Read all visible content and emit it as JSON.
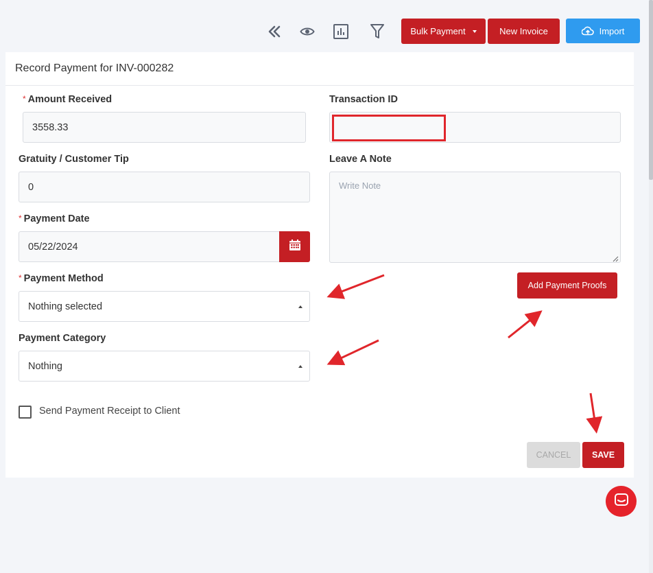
{
  "toolbar": {
    "icons": [
      "double-chevron-left-icon",
      "eye-icon",
      "bar-chart-icon",
      "filter-icon"
    ],
    "bulk_payment_label": "Bulk Payment",
    "new_invoice_label": "New Invoice",
    "import_label": "Import"
  },
  "form": {
    "title": "Record Payment for INV-000282",
    "amount_received": {
      "label": "Amount Received",
      "value": "3558.33",
      "required": true
    },
    "transaction_id": {
      "label": "Transaction ID",
      "value": ""
    },
    "gratuity": {
      "label": "Gratuity / Customer Tip",
      "value": "0"
    },
    "note": {
      "label": "Leave A Note",
      "placeholder": "Write Note"
    },
    "payment_date": {
      "label": "Payment Date",
      "value": "05/22/2024",
      "required": true
    },
    "payment_method": {
      "label": "Payment Method",
      "selected": "Nothing selected",
      "required": true
    },
    "add_proofs_label": "Add Payment Proofs",
    "payment_category": {
      "label": "Payment Category",
      "selected": "Nothing"
    },
    "send_receipt": {
      "label": "Send Payment Receipt to Client",
      "checked": false
    },
    "cancel_label": "CANCEL",
    "save_label": "SAVE"
  },
  "colors": {
    "primary_red": "#c41f24",
    "import_blue": "#2f9bef",
    "annotation_red": "#e0262b",
    "chat_red": "#e5232b"
  }
}
